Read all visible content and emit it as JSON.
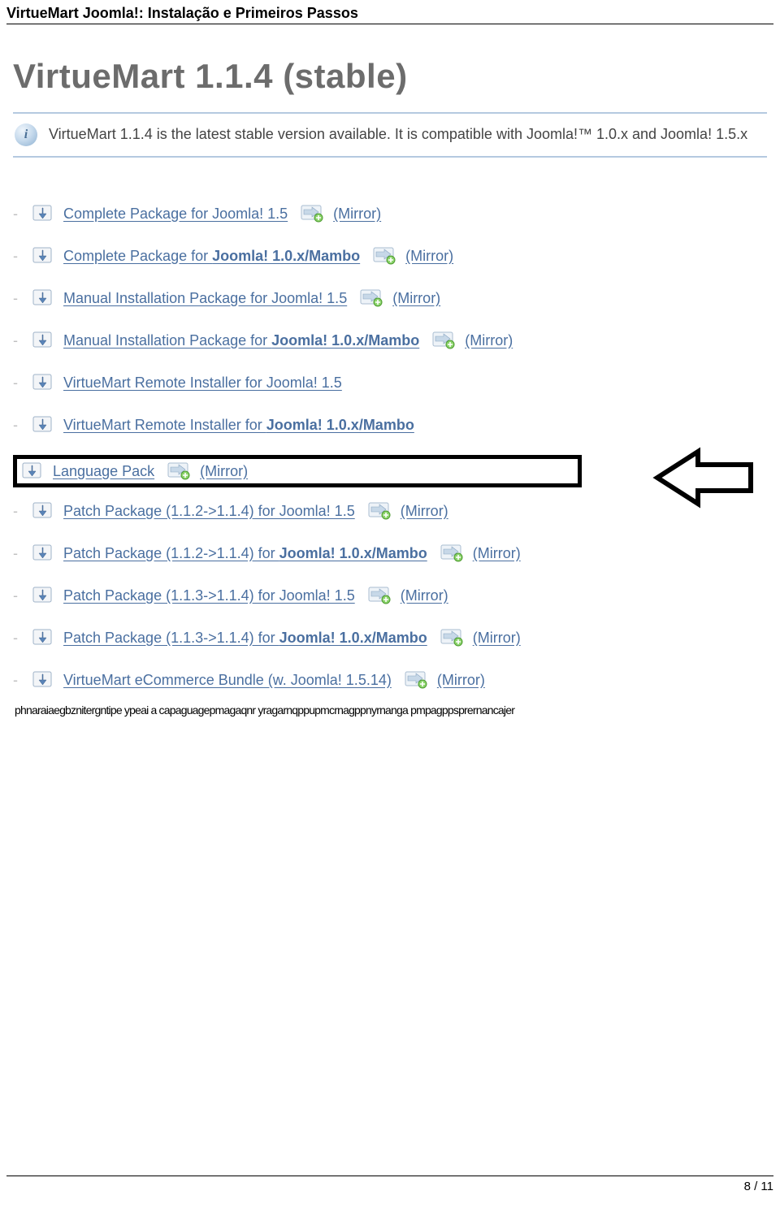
{
  "doc": {
    "headerTitle": "VirtueMart Joomla!: Instalação e Primeiros Passos",
    "pageNum": "8 / 11"
  },
  "heading": "VirtueMart 1.1.4 (stable)",
  "infoIconChar": "i",
  "infoText": "VirtueMart 1.1.4 is the latest stable version available. It is compatible with Joomla!™ 1.0.x and Joomla! 1.5.x",
  "mirrorLabel": "(Mirror)",
  "items": [
    {
      "label_plain": "Complete Package for Joomla! 1.5",
      "mirror": true
    },
    {
      "label_pre": "Complete Package for ",
      "label_bold": "Joomla! 1.0.x/Mambo",
      "mirror": true
    },
    {
      "label_plain": "Manual Installation Package for Joomla! 1.5",
      "mirror": true
    },
    {
      "label_pre": "Manual Installation Package for ",
      "label_bold": "Joomla! 1.0.x/Mambo",
      "mirror": true
    },
    {
      "label_plain": "VirtueMart Remote Installer for Joomla! 1.5",
      "mirror": false
    },
    {
      "label_pre": "VirtueMart Remote Installer for ",
      "label_bold": "Joomla! 1.0.x/Mambo",
      "mirror": false
    }
  ],
  "highlight": {
    "label_plain": "Language Pack",
    "mirror": true
  },
  "items2": [
    {
      "label_plain": "Patch Package (1.1.2->1.1.4) for Joomla! 1.5",
      "mirror": true
    },
    {
      "label_pre": "Patch Package (1.1.2->1.1.4) for ",
      "label_bold": "Joomla! 1.0.x/Mambo",
      "mirror": true
    },
    {
      "label_plain": "Patch Package (1.1.3->1.1.4) for Joomla! 1.5",
      "mirror": true
    },
    {
      "label_pre": "Patch Package (1.1.3->1.1.4) for ",
      "label_bold": "Joomla! 1.0.x/Mambo",
      "mirror": true
    },
    {
      "label_plain": "VirtueMart eCommerce Bundle (w. Joomla! 1.5.14)",
      "mirror": true
    }
  ],
  "garbled": "phnaraiaegbznitergntipe ypeai a capaguagepmagaqnr yragarnqppupmcrnagppnyrnanga pmpagppsprernancajer"
}
